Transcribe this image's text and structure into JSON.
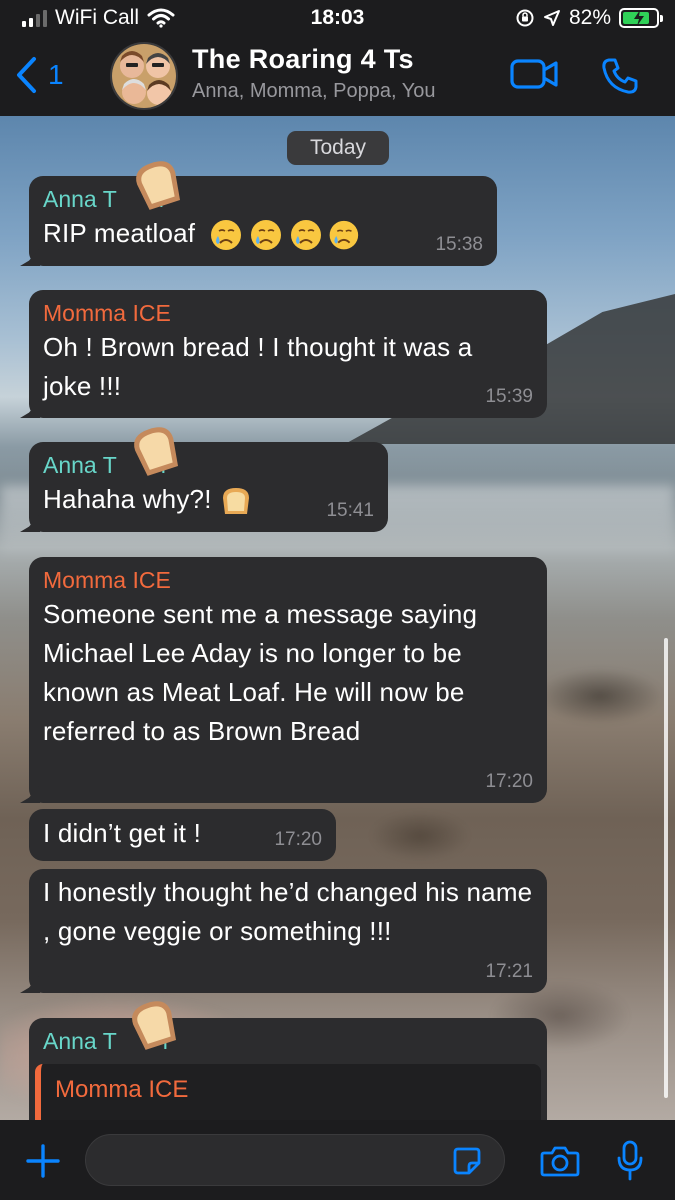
{
  "status_bar": {
    "carrier": "WiFi Call",
    "time": "18:03",
    "battery_percent": "82%",
    "battery_level": 0.82,
    "icons": [
      "cellular-signal-icon",
      "wifi-icon",
      "orientation-lock-icon",
      "location-arrow-icon",
      "battery-charging-icon"
    ]
  },
  "header": {
    "back_count": "1",
    "title": "The Roaring 4 Ts",
    "subtitle": "Anna, Momma, Poppa, You",
    "icons": [
      "chevron-left-icon",
      "group-avatar",
      "video-camera-icon",
      "phone-icon"
    ]
  },
  "chat": {
    "date_divider": "Today",
    "messages": [
      {
        "sender": "Anna T",
        "sender_tail": "r",
        "text": "RIP meatloaf",
        "emoji": "crying-face x4",
        "time": "15:38"
      },
      {
        "sender": "Momma ICE",
        "text": "Oh ! Brown bread ! I thought it was a joke !!!",
        "time": "15:39"
      },
      {
        "sender": "Anna T",
        "sender_tail": "r",
        "text": "Hahaha why?!",
        "emoji": "bread",
        "time": "15:41"
      },
      {
        "sender": "Momma ICE",
        "text": "Someone sent me a message saying Michael Lee Aday is no longer to be known as Meat Loaf. He will now be referred to as Brown Bread",
        "time": "17:20"
      },
      {
        "text": "I didn’t get it !",
        "time": "17:20"
      },
      {
        "text": "I honestly thought he’d changed his name , gone veggie or something !!!",
        "time": "17:21"
      },
      {
        "sender": "Anna T",
        "sender_tail": "r",
        "reply_to": "Momma ICE"
      }
    ],
    "colors": {
      "anna": "#68d6c9",
      "momma": "#f26a3d",
      "bubble": "#2c2c2e",
      "accent": "#0a84ff"
    }
  },
  "input_bar": {
    "placeholder": "",
    "icons": [
      "plus-icon",
      "sticker-icon",
      "camera-icon",
      "microphone-icon"
    ]
  }
}
